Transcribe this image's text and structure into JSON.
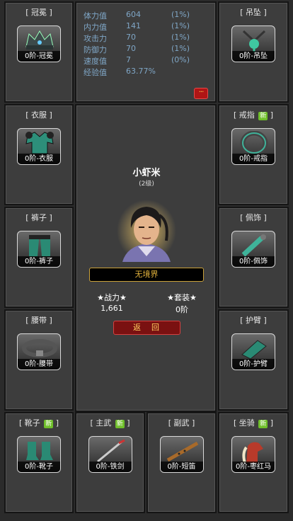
{
  "stats": [
    {
      "name": "体力值",
      "value": "604",
      "pct": "(1%)"
    },
    {
      "name": "内力值",
      "value": "141",
      "pct": "(1%)"
    },
    {
      "name": "攻击力",
      "value": "70",
      "pct": "(1%)"
    },
    {
      "name": "防御力",
      "value": "70",
      "pct": "(1%)"
    },
    {
      "name": "速度值",
      "value": "7",
      "pct": "(0%)"
    },
    {
      "name": "经验值",
      "value": "63.77%",
      "pct": ""
    }
  ],
  "more_button": "···",
  "hero": {
    "name": "小虾米",
    "level": "(2级)",
    "realm": "无境界"
  },
  "power": {
    "combat_label": "★战力★",
    "combat_value": "1,661",
    "set_label": "★套装★",
    "set_value": "0阶"
  },
  "back_button": "返　回",
  "new_badge": "新",
  "slots": {
    "crown": {
      "title": "[ 冠冕 ]",
      "item": "0阶-冠冕"
    },
    "pendant": {
      "title": "[ 吊坠 ]",
      "item": "0阶-吊坠"
    },
    "clothes": {
      "title": "[ 衣服 ]",
      "item": "0阶-衣服"
    },
    "ring": {
      "title": "[ 戒指",
      "title_end": "]",
      "item": "0阶-戒指"
    },
    "pants": {
      "title": "[ 裤子 ]",
      "item": "0阶-裤子"
    },
    "ornament": {
      "title": "[ 佩饰 ]",
      "item": "0阶-佩饰"
    },
    "belt": {
      "title": "[ 腰带 ]",
      "item": "0阶-腰带"
    },
    "armguard": {
      "title": "[ 护臂 ]",
      "item": "0阶-护臂"
    },
    "boots": {
      "title": "[ 靴子",
      "title_end": "]",
      "item": "0阶-靴子"
    },
    "main_weapon": {
      "title": "[ 主武",
      "title_end": "]",
      "item": "0阶-铁剑"
    },
    "sub_weapon": {
      "title": "[ 副武 ]",
      "item": "0阶-短笛"
    },
    "mount": {
      "title": "[ 坐骑",
      "title_end": "]",
      "item": "0阶-枣红马"
    }
  }
}
